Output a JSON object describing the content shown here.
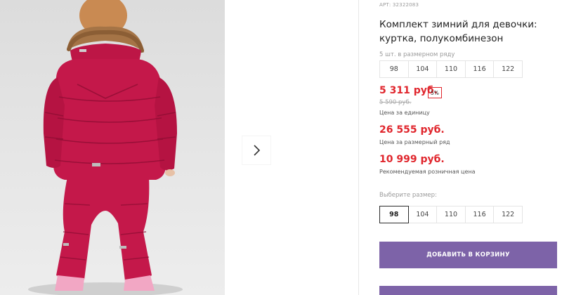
{
  "product": {
    "sku": "АРТ: 32322083",
    "title": "Комплект зимний для девочки: куртка, полукомбинезон",
    "pack_note": "5 шт. в размерном ряду",
    "pack_sizes": [
      "98",
      "104",
      "110",
      "116",
      "122"
    ],
    "price_unit": "5 311 руб.",
    "discount": "5%",
    "old_price": "5 590 руб.",
    "price_unit_caption": "Цена за единицу",
    "price_row": "26 555 руб.",
    "price_row_caption": "Цена за размерный ряд",
    "price_rrp": "10 999 руб.",
    "price_rrp_caption": "Рекомендуемая розничная цена",
    "size_select_label": "Выберите размер:",
    "select_sizes": [
      "98",
      "104",
      "110",
      "116",
      "122"
    ],
    "selected_size": "98",
    "add_to_cart_label": "ДОБАВИТЬ В КОРЗИНУ"
  },
  "gallery": {
    "next_icon": "chevron-right-icon",
    "photo_subject": "girl in red winter jacket and bib pants, back view"
  },
  "colors": {
    "accent": "#7d63a8",
    "price_red": "#e0262d",
    "jacket": "#c4184a"
  }
}
